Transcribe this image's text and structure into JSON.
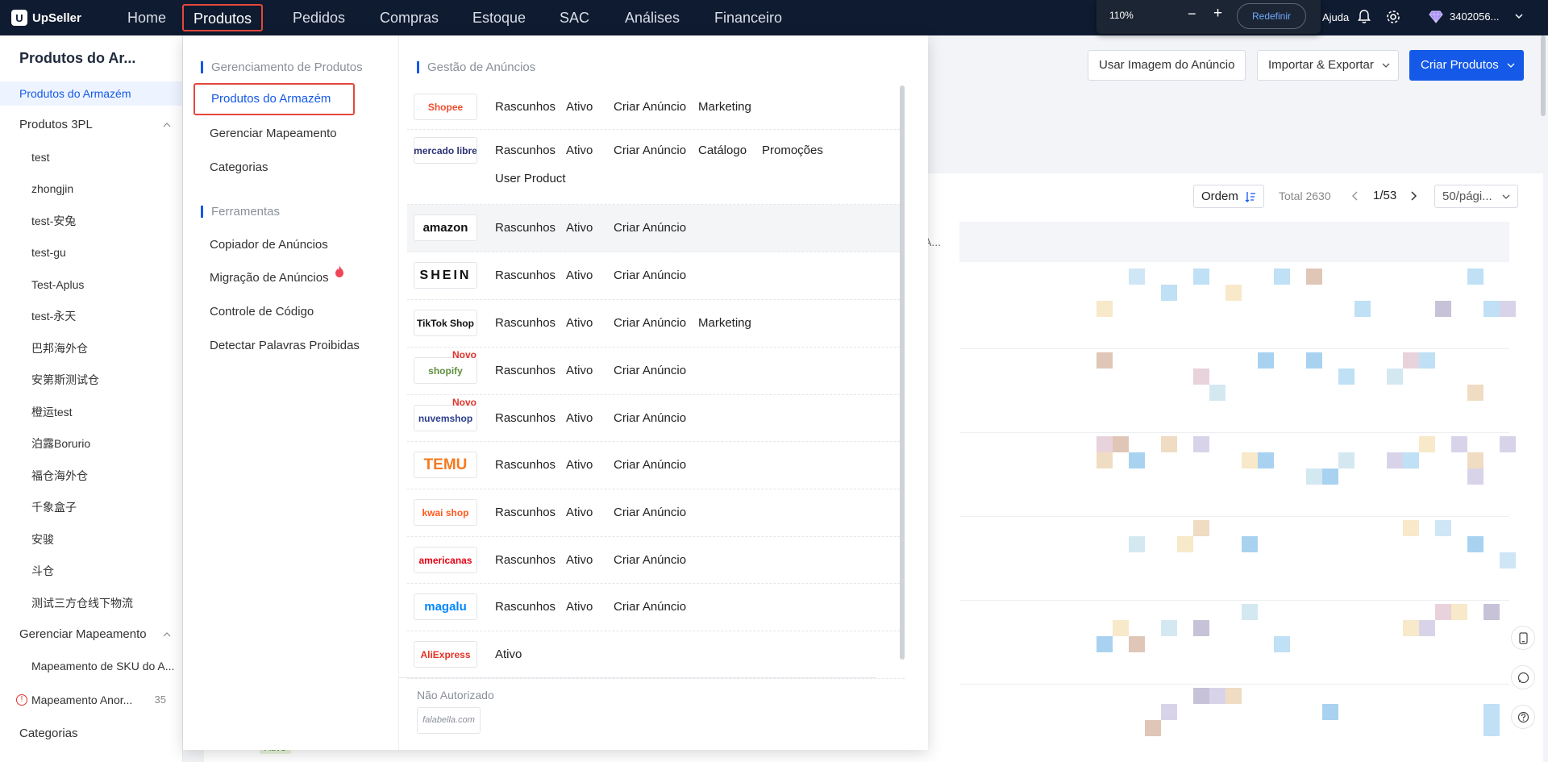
{
  "app": {
    "name": "UpSeller"
  },
  "nav": {
    "items": [
      "Home",
      "Produtos",
      "Pedidos",
      "Compras",
      "Estoque",
      "SAC",
      "Análises",
      "Financeiro"
    ],
    "active": "Produtos"
  },
  "zoom": {
    "level": "110%",
    "minus": "−",
    "plus": "+",
    "reset_label": "Redefinir"
  },
  "header_right": {
    "help": "Ajuda",
    "account": "3402056..."
  },
  "sidebar": {
    "title": "Produtos do Ar...",
    "items": [
      {
        "label": "Produtos do Armazém",
        "type": "active"
      },
      {
        "label": "Produtos 3PL",
        "type": "parent"
      },
      {
        "label": "test",
        "type": "child"
      },
      {
        "label": "zhongjin",
        "type": "child"
      },
      {
        "label": "test-安兔",
        "type": "child"
      },
      {
        "label": "test-gu",
        "type": "child"
      },
      {
        "label": "Test-Aplus",
        "type": "child"
      },
      {
        "label": "test-永天",
        "type": "child"
      },
      {
        "label": "巴邦海外仓",
        "type": "child"
      },
      {
        "label": "安第斯测试仓",
        "type": "child"
      },
      {
        "label": "橙运test",
        "type": "child"
      },
      {
        "label": "泊露Borurio",
        "type": "child"
      },
      {
        "label": "福仓海外仓",
        "type": "child"
      },
      {
        "label": "千象盒子",
        "type": "child"
      },
      {
        "label": "安骏",
        "type": "child"
      },
      {
        "label": "斗仓",
        "type": "child"
      },
      {
        "label": "测试三方仓线下物流",
        "type": "child"
      },
      {
        "label": "Gerenciar Mapeamento",
        "type": "parent"
      },
      {
        "label": "Mapeamento de SKU do A...",
        "type": "child"
      },
      {
        "label": "Mapeamento Anor...",
        "type": "child",
        "badge": "35",
        "warn": "!"
      },
      {
        "label": "Categorias",
        "type": "parent"
      }
    ]
  },
  "toolbar": {
    "use_image": "Usar Imagem do Anúncio",
    "import_export": "Importar & Exportar",
    "create": "Criar Produtos"
  },
  "table": {
    "order_label": "Ordem",
    "total": "Total 2630",
    "page": "1/53",
    "per_page": "50/pági...",
    "col_trunc": "A...",
    "status_tag": "Ativo"
  },
  "dropdown": {
    "section_management": "Gerenciamento de Produtos",
    "management_links": [
      "Produtos do Armazém",
      "Gerenciar Mapeamento",
      "Categorias"
    ],
    "section_tools": "Ferramentas",
    "tools_links": [
      "Copiador de Anúncios",
      "Migração de Anúncios",
      "Controle de Código",
      "Detectar Palavras Proibidas"
    ],
    "ads_title": "Gestão de Anúncios",
    "marketplaces": [
      {
        "logo": "Shopee",
        "color": "#ee4d2d",
        "links": [
          "Rascunhos",
          "Ativo",
          "Criar Anúncio",
          "Marketing"
        ]
      },
      {
        "logo": "mercado libre",
        "color": "#2d3277",
        "links": [
          "Rascunhos",
          "Ativo",
          "Criar Anúncio",
          "Catálogo",
          "Promoções"
        ],
        "links2": [
          "User Product"
        ]
      },
      {
        "logo": "amazon",
        "color": "#111111",
        "links": [
          "Rascunhos",
          "Ativo",
          "Criar Anúncio"
        ]
      },
      {
        "logo": "SHEIN",
        "color": "#111111",
        "links": [
          "Rascunhos",
          "Ativo",
          "Criar Anúncio"
        ]
      },
      {
        "logo": "TikTok Shop",
        "color": "#111111",
        "links": [
          "Rascunhos",
          "Ativo",
          "Criar Anúncio",
          "Marketing"
        ]
      },
      {
        "logo": "shopify",
        "color": "#5e8e3e",
        "badge": "Novo",
        "links": [
          "Rascunhos",
          "Ativo",
          "Criar Anúncio"
        ]
      },
      {
        "logo": "nuvemshop",
        "color": "#2c3e8f",
        "badge": "Novo",
        "links": [
          "Rascunhos",
          "Ativo",
          "Criar Anúncio"
        ]
      },
      {
        "logo": "TEMU",
        "color": "#f57a20",
        "links": [
          "Rascunhos",
          "Ativo",
          "Criar Anúncio"
        ]
      },
      {
        "logo": "kwai shop",
        "color": "#ff5a1f",
        "links": [
          "Rascunhos",
          "Ativo",
          "Criar Anúncio"
        ]
      },
      {
        "logo": "americanas",
        "color": "#e60014",
        "links": [
          "Rascunhos",
          "Ativo",
          "Criar Anúncio"
        ]
      },
      {
        "logo": "magalu",
        "color": "#0086ff",
        "links": [
          "Rascunhos",
          "Ativo",
          "Criar Anúncio"
        ]
      },
      {
        "logo": "AliExpress",
        "color": "#e43225",
        "links": [
          "Ativo"
        ]
      }
    ],
    "unauthorized_title": "Não Autorizado",
    "unauthorized_logo": "falabella.com"
  },
  "colors": {
    "accent": "#1459e8",
    "topbar": "#0f1b30",
    "highlight_border": "#e4473b"
  }
}
